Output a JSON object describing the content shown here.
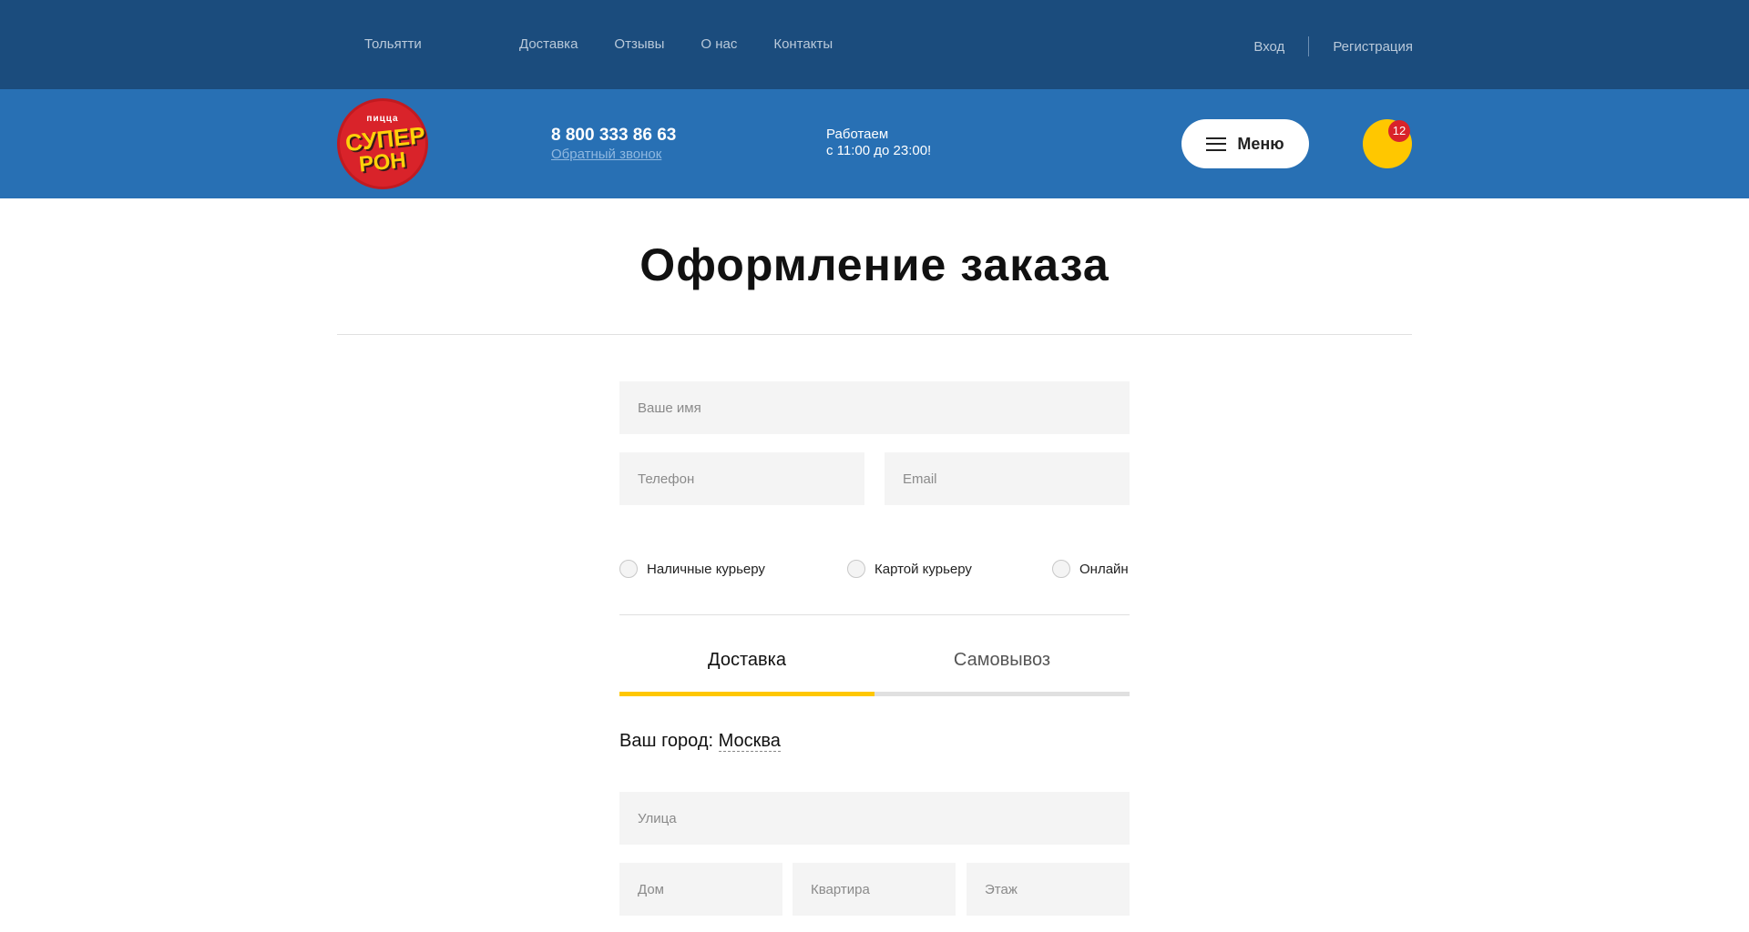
{
  "topbar": {
    "city": "Тольятти",
    "nav": [
      "Доставка",
      "Отзывы",
      "О нас",
      "Контакты"
    ],
    "login": "Вход",
    "register": "Регистрация"
  },
  "header": {
    "logo": {
      "small": "пицца",
      "line1": "СУПЕР",
      "line2": "РОН"
    },
    "phone": "8 800 333 86 63",
    "callback": "Обратный звонок",
    "hours_line1": "Работаем",
    "hours_line2": "с 11:00 до 23:00!",
    "menu_label": "Меню",
    "cart_count": "12"
  },
  "page": {
    "title": "Оформление заказа"
  },
  "form": {
    "name_placeholder": "Ваше имя",
    "phone_placeholder": "Телефон",
    "email_placeholder": "Email",
    "payment": [
      "Наличные курьеру",
      "Картой курьеру",
      "Онлайн"
    ],
    "tabs": {
      "delivery": "Доставка",
      "pickup": "Самовывоз",
      "active": "delivery"
    },
    "city_label": "Ваш город:",
    "city_value": "Москва",
    "street_placeholder": "Улица",
    "house_placeholder": "Дом",
    "apartment_placeholder": "Квартира",
    "floor_placeholder": "Этаж"
  },
  "colors": {
    "topbar_bg": "#1b4c7d",
    "header_bg": "#2870b4",
    "accent_yellow": "#ffc700",
    "badge_red": "#d9232a",
    "tab_inactive": "#e0e0e0"
  }
}
